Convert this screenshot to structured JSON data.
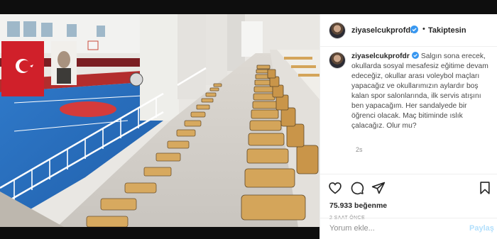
{
  "post": {
    "username": "ziyaselcukprofdr",
    "follow_status": "Takiptesin",
    "separator": "•",
    "caption": "Salgın sona erecek, okullarda sosyal mesafesiz eğitime devam edeceğiz, okullar arası voleybol maçları yapacağız ve okullarımızın aylardır boş kalan spor salonlarında, ilk servis atışını ben yapacağım. Her sandalyede bir öğrenci olacak. Maç bitiminde ıslık çalacağız. Olur mu?",
    "time_ago": "2s",
    "likes": "75.933 beğenme",
    "posted_ago": "2 SAAT ÖNCE",
    "comment_placeholder": "Yorum ekle...",
    "share_label": "Paylaş"
  },
  "icons": {
    "verified": "verified-badge-icon",
    "like": "heart-icon",
    "comment": "comment-icon",
    "share": "paper-plane-icon",
    "save": "bookmark-icon"
  },
  "colors": {
    "verified_blue": "#3897f0",
    "muted": "#8e8e8e",
    "text": "#262626",
    "share_disabled": "#b2dffc"
  }
}
